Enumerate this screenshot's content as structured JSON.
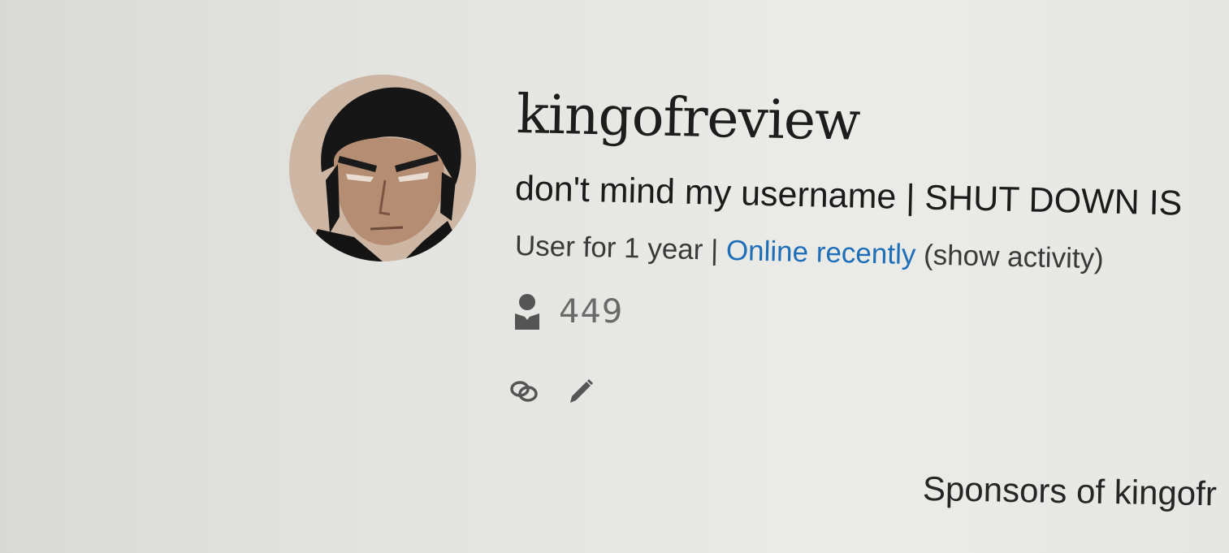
{
  "profile": {
    "username": "kingofreview",
    "bio": "don't mind my username | SHUT DOWN IS",
    "meta": {
      "member_for": "User for 1 year",
      "separator": " | ",
      "online_status": "Online recently",
      "show_activity": " (show activity)"
    },
    "followers": {
      "icon": "person-icon",
      "count": "449"
    },
    "actions": {
      "link_icon": "link-icon",
      "edit_icon": "pencil-icon"
    }
  },
  "sponsors": {
    "heading": "Sponsors of kingofr"
  },
  "colors": {
    "link": "#1f6fb8",
    "text": "#1b1b1b",
    "muted": "#6a6a6a"
  }
}
